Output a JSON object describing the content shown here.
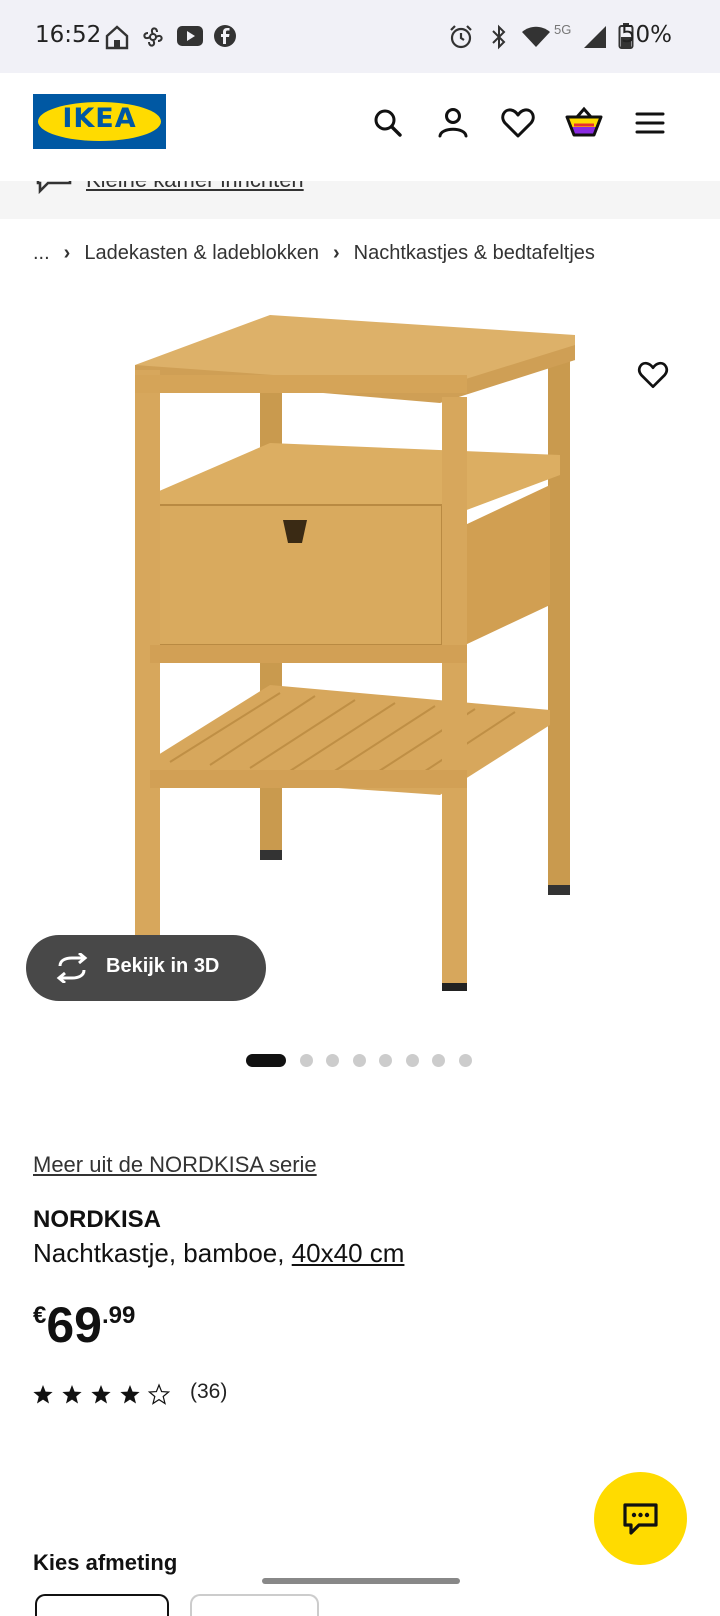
{
  "status_bar": {
    "time": "16:52",
    "battery": "50%",
    "network": "5G",
    "left_icons": [
      "home-app-icon",
      "pinwheel-icon",
      "youtube-icon",
      "facebook-icon"
    ],
    "right_icons": [
      "alarm-icon",
      "bluetooth-icon",
      "wifi-icon",
      "signal-icon",
      "battery-icon"
    ]
  },
  "header": {
    "logo_text": "IKEA",
    "icons": [
      "search-icon",
      "account-icon",
      "heart-icon",
      "basket-icon",
      "menu-icon"
    ]
  },
  "banner": {
    "text": "Kleine kamer inrichten"
  },
  "breadcrumb": {
    "ellipsis": "...",
    "items": [
      "Ladekasten & ladeblokken",
      "Nachtkastjes & bedtafeltjes"
    ]
  },
  "gallery": {
    "view_3d_label": "Bekijk in 3D",
    "total_images": 8,
    "active_index": 0
  },
  "product": {
    "series_link": "Meer uit de NORDKISA serie",
    "name": "NORDKISA",
    "description": "Nachtkastje, bamboe,",
    "size_link": "40x40 cm",
    "price_currency": "€",
    "price_int": "69",
    "price_dec": ".99",
    "rating": 4.5,
    "review_count": "(36)"
  },
  "size_section": {
    "title": "Kies afmeting"
  },
  "colors": {
    "ikea_blue": "#0058a3",
    "ikea_yellow": "#ffdb00",
    "bamboo": "#d9a85a"
  }
}
